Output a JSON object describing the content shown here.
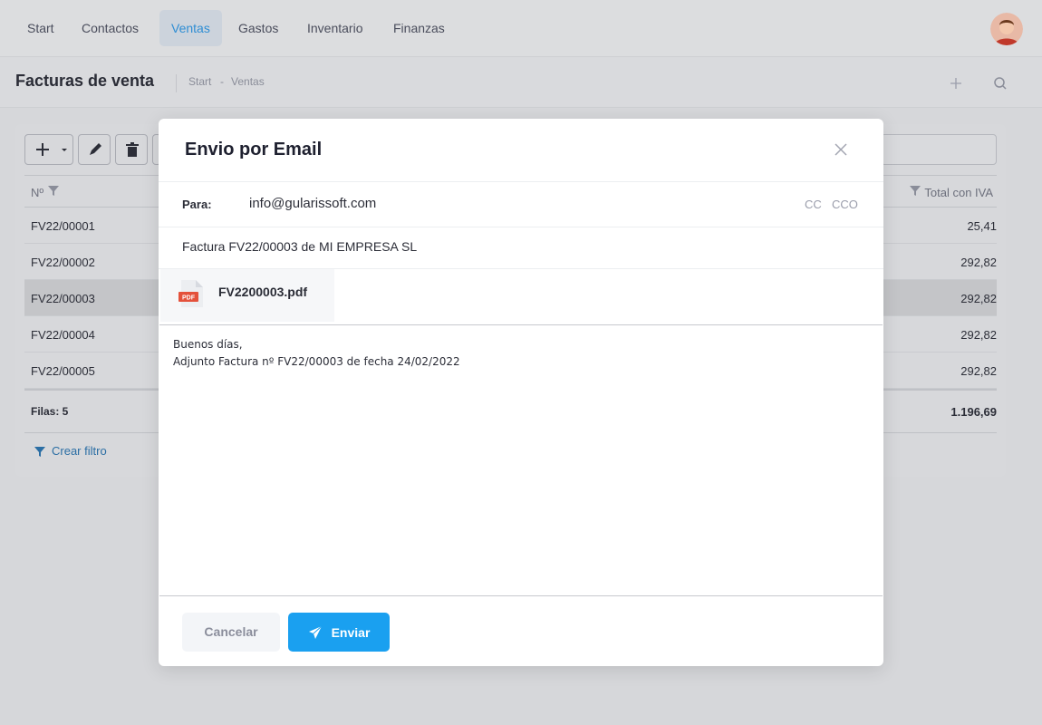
{
  "nav": {
    "items": [
      {
        "label": "Start"
      },
      {
        "label": "Contactos"
      },
      {
        "label": "Ventas"
      },
      {
        "label": "Gastos"
      },
      {
        "label": "Inventario"
      },
      {
        "label": "Finanzas"
      }
    ],
    "active": "Ventas"
  },
  "subheader": {
    "title": "Facturas de venta",
    "breadcrumb": [
      "Start",
      "-",
      "Ventas"
    ]
  },
  "table": {
    "columns": [
      "Nº",
      "Total con IVA"
    ],
    "rows": [
      {
        "num": "FV22/00001",
        "total": "25,41"
      },
      {
        "num": "FV22/00002",
        "total": "292,82"
      },
      {
        "num": "FV22/00003",
        "total": "292,82",
        "selected": true
      },
      {
        "num": "FV22/00004",
        "total": "292,82"
      },
      {
        "num": "FV22/00005",
        "total": "292,82"
      }
    ],
    "footer_label": "Filas: 5",
    "footer_total": "1.196,69",
    "filter_link": "Crear filtro"
  },
  "modal": {
    "title": "Envio por Email",
    "to_label": "Para:",
    "to_value": "info@gularissoft.com",
    "cc": "CC",
    "cco": "CCO",
    "subject": "Factura FV22/00003 de MI EMPRESA SL",
    "attachment": {
      "name": "FV2200003.pdf",
      "icon": "pdf-file-icon",
      "badge": "PDF"
    },
    "body_lines": [
      "Buenos días,",
      "Adjunto Factura nº FV22/00003 de fecha 24/02/2022"
    ],
    "cancel_label": "Cancelar",
    "send_label": "Enviar"
  },
  "colors": {
    "accent": "#1aa0f0",
    "nav_active": "#2f8ed4",
    "pdf_red": "#e4513b"
  }
}
